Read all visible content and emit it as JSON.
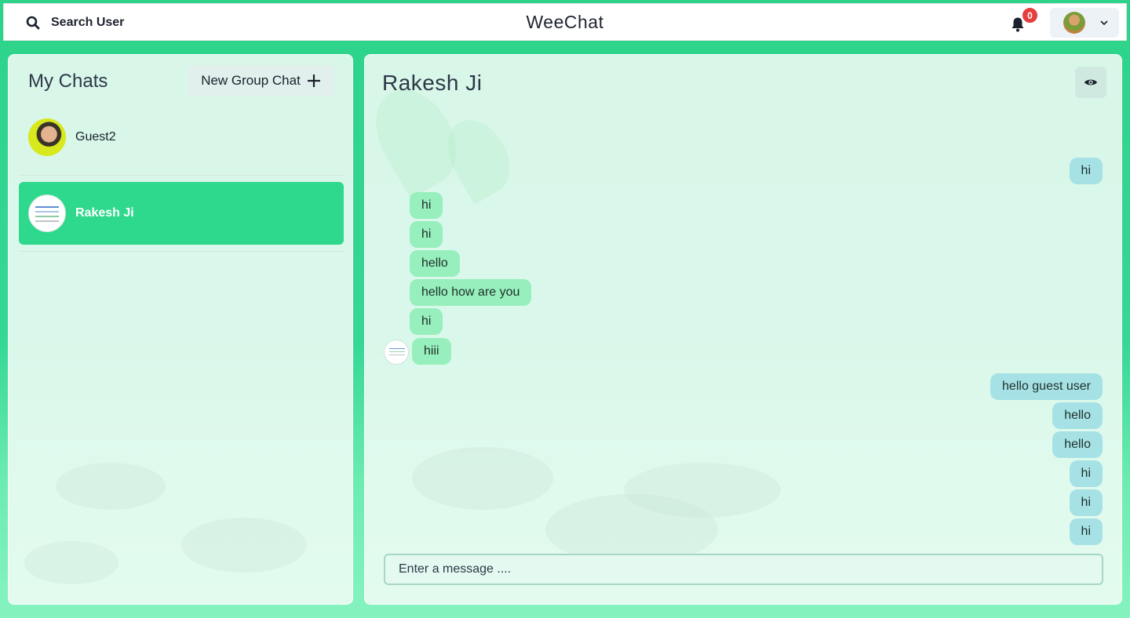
{
  "header": {
    "search_label": "Search User",
    "app_title": "WeeChat",
    "notification_count": "0"
  },
  "sidebar": {
    "title": "My Chats",
    "new_group_label": "New Group Chat",
    "chats": [
      {
        "name": "Guest2",
        "active": false
      },
      {
        "name": "Rakesh Ji",
        "active": true
      }
    ]
  },
  "chat": {
    "title": "Rakesh Ji",
    "messages": [
      {
        "text": "hi",
        "direction": "sent"
      },
      {
        "text": "hi",
        "direction": "received"
      },
      {
        "text": "hi",
        "direction": "received"
      },
      {
        "text": "hello",
        "direction": "received"
      },
      {
        "text": "hello how are you",
        "direction": "received"
      },
      {
        "text": "hi",
        "direction": "received"
      },
      {
        "text": "hiii",
        "direction": "received"
      },
      {
        "text": "hello guest user",
        "direction": "sent"
      },
      {
        "text": "hello",
        "direction": "sent"
      },
      {
        "text": "hello",
        "direction": "sent"
      },
      {
        "text": "hi",
        "direction": "sent"
      },
      {
        "text": "hi",
        "direction": "sent"
      },
      {
        "text": "hi",
        "direction": "sent"
      }
    ],
    "input_placeholder": "Enter a message ...."
  },
  "colors": {
    "accent": "#2ed88d",
    "sent_bubble": "#a6e2e5",
    "received_bubble": "#96efbc",
    "badge": "#e53e3e"
  },
  "icons": [
    "search-icon",
    "bell-icon",
    "chevron-down-icon",
    "plus-icon",
    "eye-icon"
  ]
}
